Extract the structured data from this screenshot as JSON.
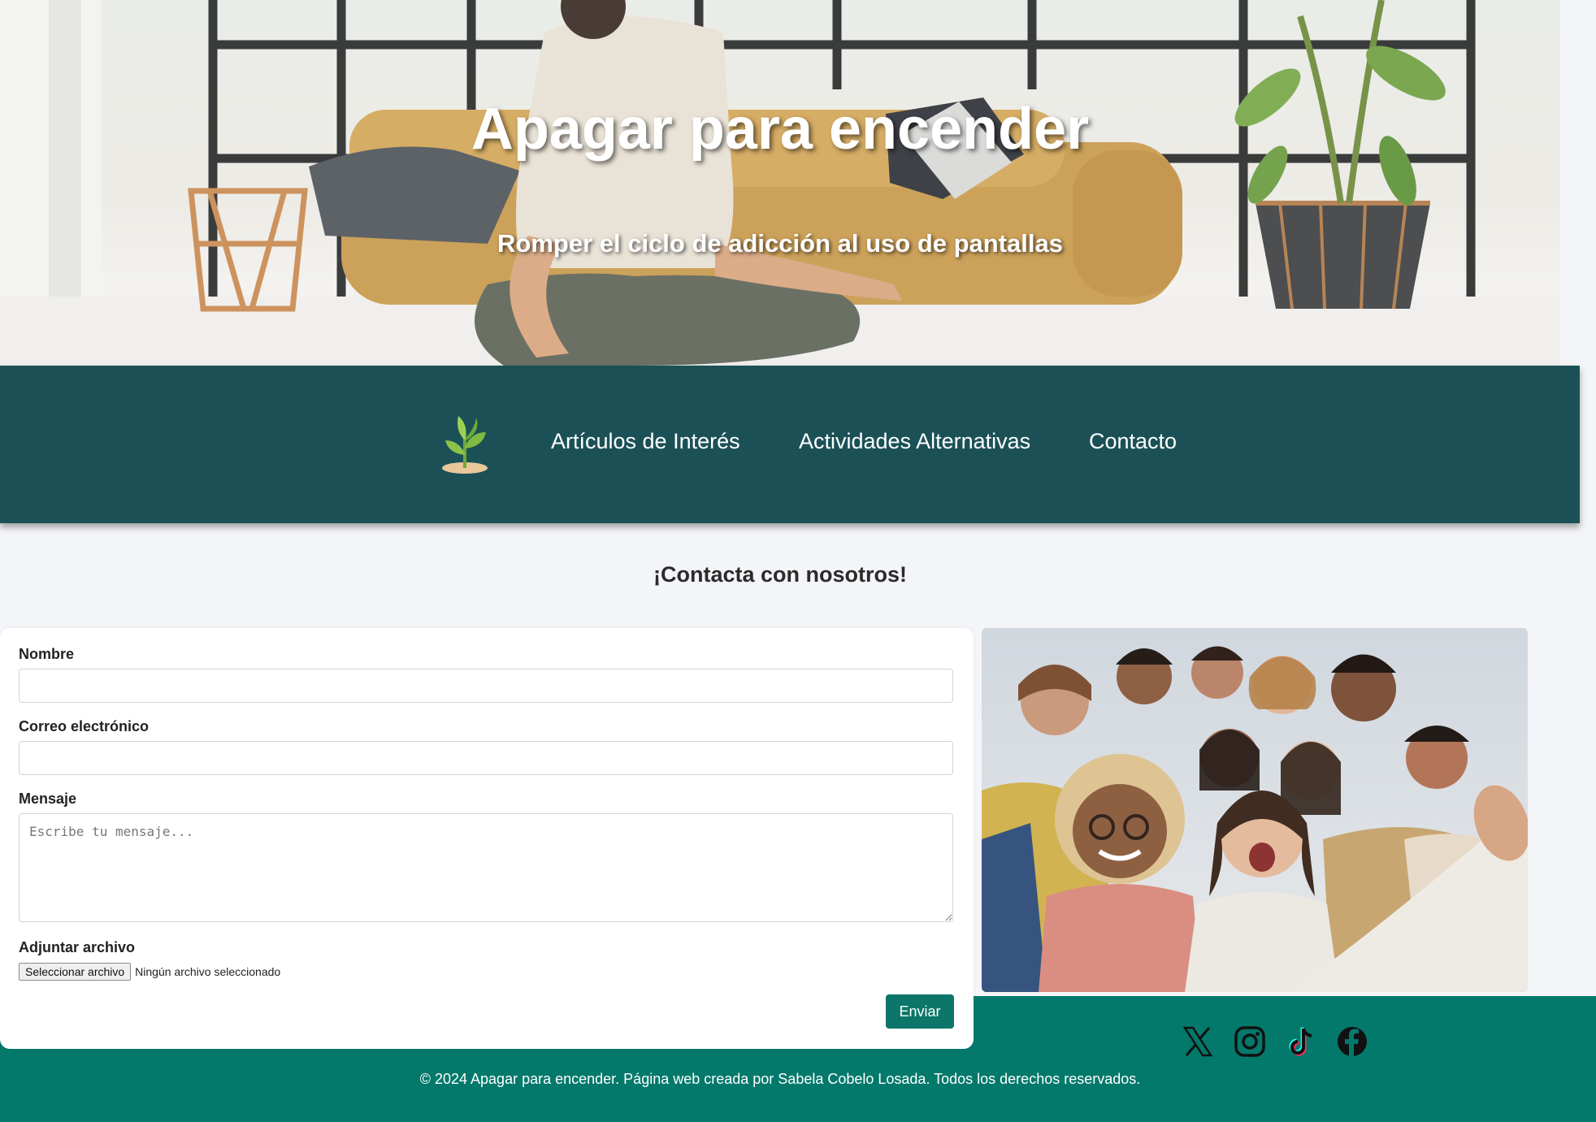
{
  "hero": {
    "title": "Apagar para encender",
    "subtitle": "Romper el ciclo de adicción al uso de pantallas"
  },
  "nav": {
    "logo_icon": "sprout-icon",
    "links": [
      {
        "label": "Artículos de Interés"
      },
      {
        "label": "Actividades Alternativas"
      },
      {
        "label": "Contacto"
      }
    ]
  },
  "contact": {
    "heading": "¡Contacta con nosotros!",
    "form": {
      "name_label": "Nombre",
      "name_value": "",
      "email_label": "Correo electrónico",
      "email_value": "",
      "message_label": "Mensaje",
      "message_placeholder": "Escribe tu mensaje...",
      "attach_label": "Adjuntar archivo",
      "file_button": "Seleccionar archivo",
      "file_status": "Ningún archivo seleccionado",
      "submit_label": "Enviar"
    },
    "photo_icon": "group-selfie-photo"
  },
  "footer": {
    "social": [
      {
        "icon": "x-icon"
      },
      {
        "icon": "instagram-icon"
      },
      {
        "icon": "tiktok-icon"
      },
      {
        "icon": "facebook-icon"
      }
    ],
    "copyright": "© 2024 Apagar para encender. Página web creada por Sabela Cobelo Losada. Todos los derechos reservados."
  },
  "colors": {
    "nav_bg": "#1b5156",
    "footer_bg": "#03796b",
    "button_bg": "#0b7669",
    "page_bg": "#f4f5f8"
  }
}
